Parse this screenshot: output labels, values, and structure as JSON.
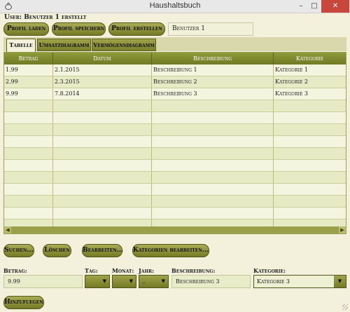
{
  "window": {
    "title": "Haushaltsbuch",
    "minimize_glyph": "–",
    "maximize_glyph": "□",
    "close_glyph": "✕"
  },
  "header": {
    "user_status": "User: Benutzer 1 erstellt",
    "buttons": {
      "load_profile": "Profil laden",
      "save_profile": "Profil speichern",
      "create_profile": "Profil erstellen"
    },
    "profile_name": "Benutzer 1"
  },
  "tabs": [
    {
      "label": "Tabelle",
      "active": true
    },
    {
      "label": "Umsatzdiagramm",
      "active": false
    },
    {
      "label": "Vermögensdiagramm",
      "active": false
    }
  ],
  "table": {
    "columns": [
      "Betrag",
      "Datum",
      "Beschreibung",
      "Kategorie"
    ],
    "rows": [
      {
        "amount": "1.99",
        "date": "2.1.2015",
        "description": "Beschreibung 1",
        "category": "Kategorie 1"
      },
      {
        "amount": "2.99",
        "date": "2.3.2015",
        "description": "Beschreibung 2",
        "category": "Kategorie 2"
      },
      {
        "amount": "9.99",
        "date": "7.8.2014",
        "description": "Beschreibung 3",
        "category": "Kategorie 3"
      }
    ]
  },
  "actions": {
    "search": "Suchen...",
    "delete": "Löschen",
    "edit": "Bearbeiten...",
    "edit_categories": "Kategorien bearbeiten..."
  },
  "form": {
    "labels": {
      "amount": "Betrag:",
      "day": "Tag:",
      "month": "Monat:",
      "year": "Jahr:",
      "description": "Beschreibung:",
      "category": "Kategorie:"
    },
    "values": {
      "amount": "9.99",
      "day": "",
      "month": "",
      "year": "..",
      "description": "Beschreibung 3",
      "category": "Kategorie 3"
    },
    "add_button": "Hinzufuegen"
  },
  "colors": {
    "accent": "#7a7f2a",
    "header_green": "#6f7a24",
    "background": "#f3f1dc",
    "row_light": "#f3f5de",
    "row_dark": "#e6ebc6"
  }
}
